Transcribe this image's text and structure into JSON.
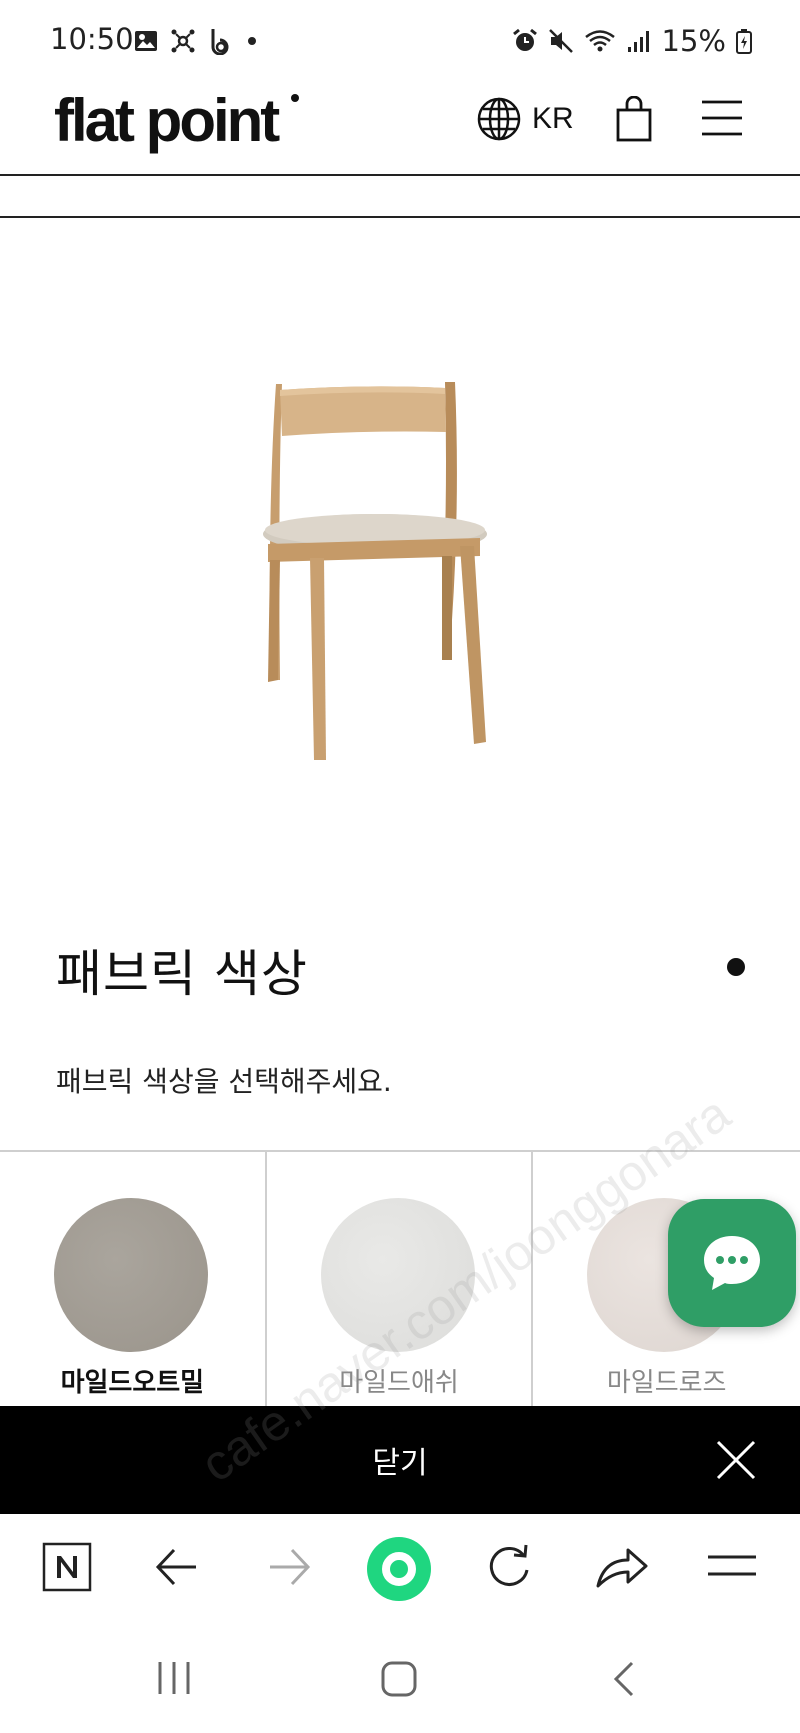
{
  "status_bar": {
    "time": "10:50",
    "battery": "15%"
  },
  "header": {
    "logo": "flat point",
    "language": "KR"
  },
  "option": {
    "title": "패브릭 색상",
    "description": "패브릭 색상을 선택해주세요."
  },
  "swatches": [
    {
      "label": "마일드오트밀",
      "color": "#a39e96",
      "selected": true
    },
    {
      "label": "마일드애쉬",
      "color": "#e3e3e1",
      "selected": false
    },
    {
      "label": "마일드로즈",
      "color": "#e6dfdb",
      "selected": false
    }
  ],
  "close_bar": {
    "label": "닫기"
  },
  "colors": {
    "chat_fab": "#2f9e66",
    "browser_home": "#1fd680",
    "close_bar_bg": "#000000"
  },
  "watermark": {
    "text": "cafe.naver.com/joonggonara"
  }
}
